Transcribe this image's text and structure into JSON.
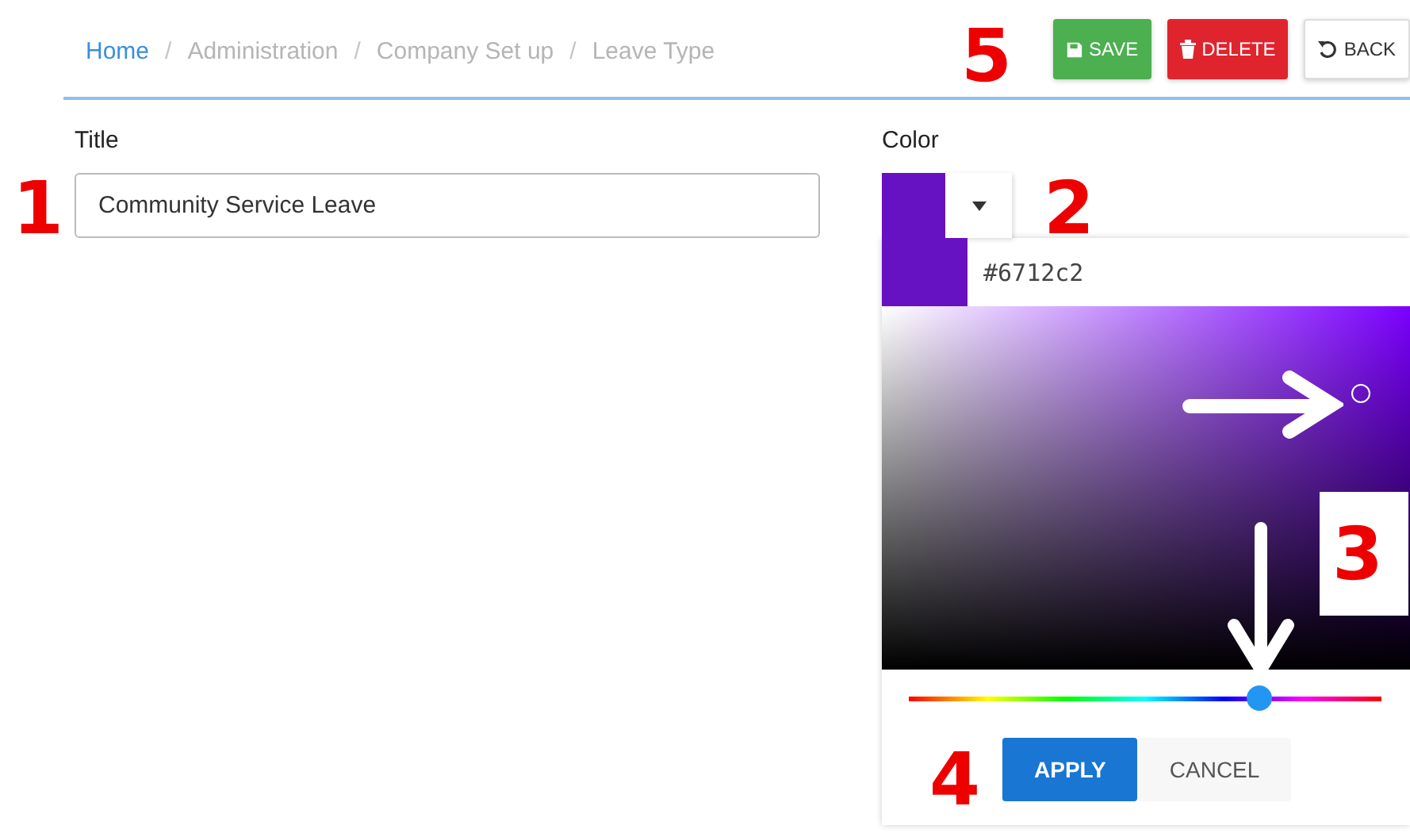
{
  "breadcrumb": [
    {
      "label": "Home",
      "link": true
    },
    {
      "label": "Administration",
      "link": false
    },
    {
      "label": "Company Set up",
      "link": false
    },
    {
      "label": "Leave Type",
      "link": false
    }
  ],
  "breadcrumb_separator": "/",
  "toolbar": [
    {
      "label": "SAVE",
      "kind": "save"
    },
    {
      "label": "DELETE",
      "kind": "delete"
    },
    {
      "label": "BACK",
      "kind": "back"
    }
  ],
  "title_field": {
    "label": "Title",
    "value": "Community Service Leave"
  },
  "color_field": {
    "label": "Color",
    "expanded": true
  },
  "color_picker": {
    "hex": "#6712c2",
    "hue_slider": {
      "level": 0.74
    },
    "buttons": [
      {
        "label": "APPLY",
        "kind": "primary"
      },
      {
        "label": "CANCEL",
        "kind": "secondary"
      }
    ]
  },
  "annotations": [
    {
      "text": "1",
      "kind": "number"
    },
    {
      "text": "2",
      "kind": "number"
    },
    {
      "text": "3",
      "kind": "boxed-number"
    },
    {
      "text": "4",
      "kind": "number"
    },
    {
      "text": "5",
      "kind": "number"
    },
    {
      "kind": "arrow-right"
    },
    {
      "kind": "arrow-down"
    }
  ]
}
